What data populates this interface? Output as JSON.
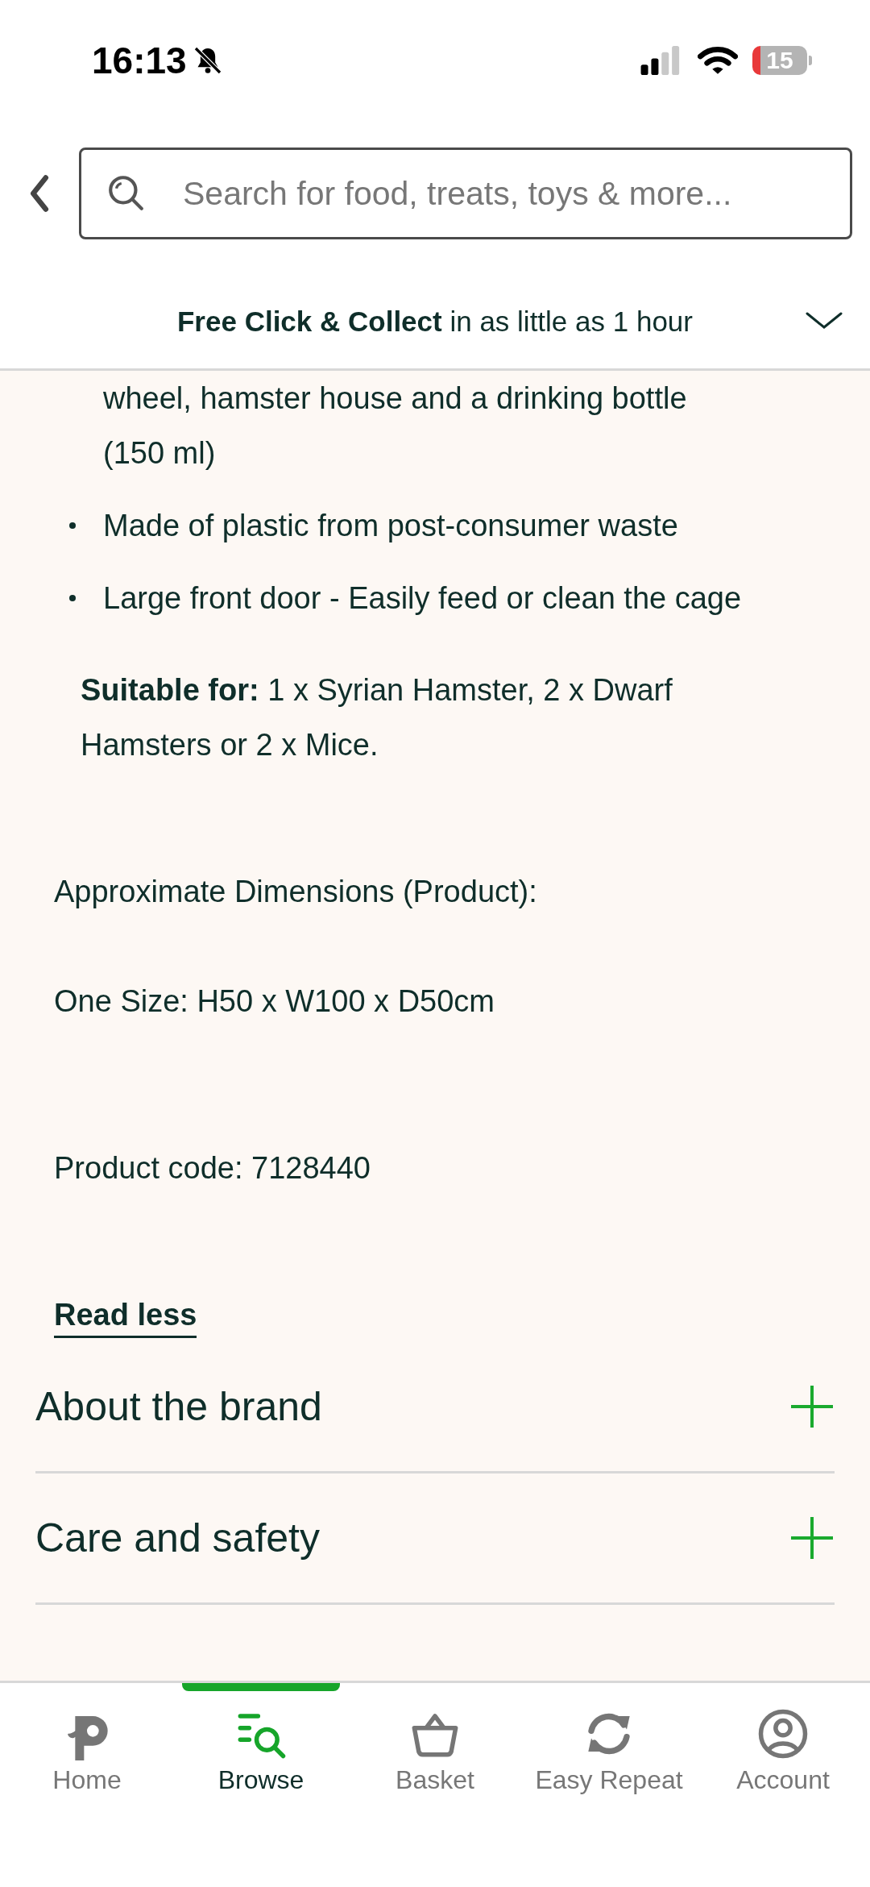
{
  "status_bar": {
    "time": "16:13",
    "silent": true,
    "battery": "15"
  },
  "header": {
    "search": {
      "placeholder": "Search for food, treats, toys & more..."
    }
  },
  "banner": {
    "text": "**Free Click & Collect** in as little as 1 hour"
  },
  "description": {
    "partial_item": "wheel, hamster house and a drinking bottle (150 ml)",
    "bullets": [
      "Made of plastic from post-consumer waste",
      "Large front door - Easily feed or clean the cage"
    ],
    "suitable": "**Suitable for:** 1 x Syrian Hamster, 2 x Dwarf Hamsters or 2 x Mice.",
    "dimensions_heading": "Approximate Dimensions (Product):",
    "dimensions": "One Size: H50 x W100 x D50cm",
    "product_code": "Product code: 7128440",
    "toggle": "Read less"
  },
  "sections": [
    {
      "title": "About the brand",
      "expanded": false
    },
    {
      "title": "Care and safety",
      "expanded": false
    }
  ],
  "tab_bar": [
    {
      "label": "Home",
      "selected": false
    },
    {
      "label": "Browse",
      "selected": true
    },
    {
      "label": "Basket",
      "selected": false
    },
    {
      "label": "Easy Repeat",
      "selected": false
    },
    {
      "label": "Account",
      "selected": false
    }
  ]
}
